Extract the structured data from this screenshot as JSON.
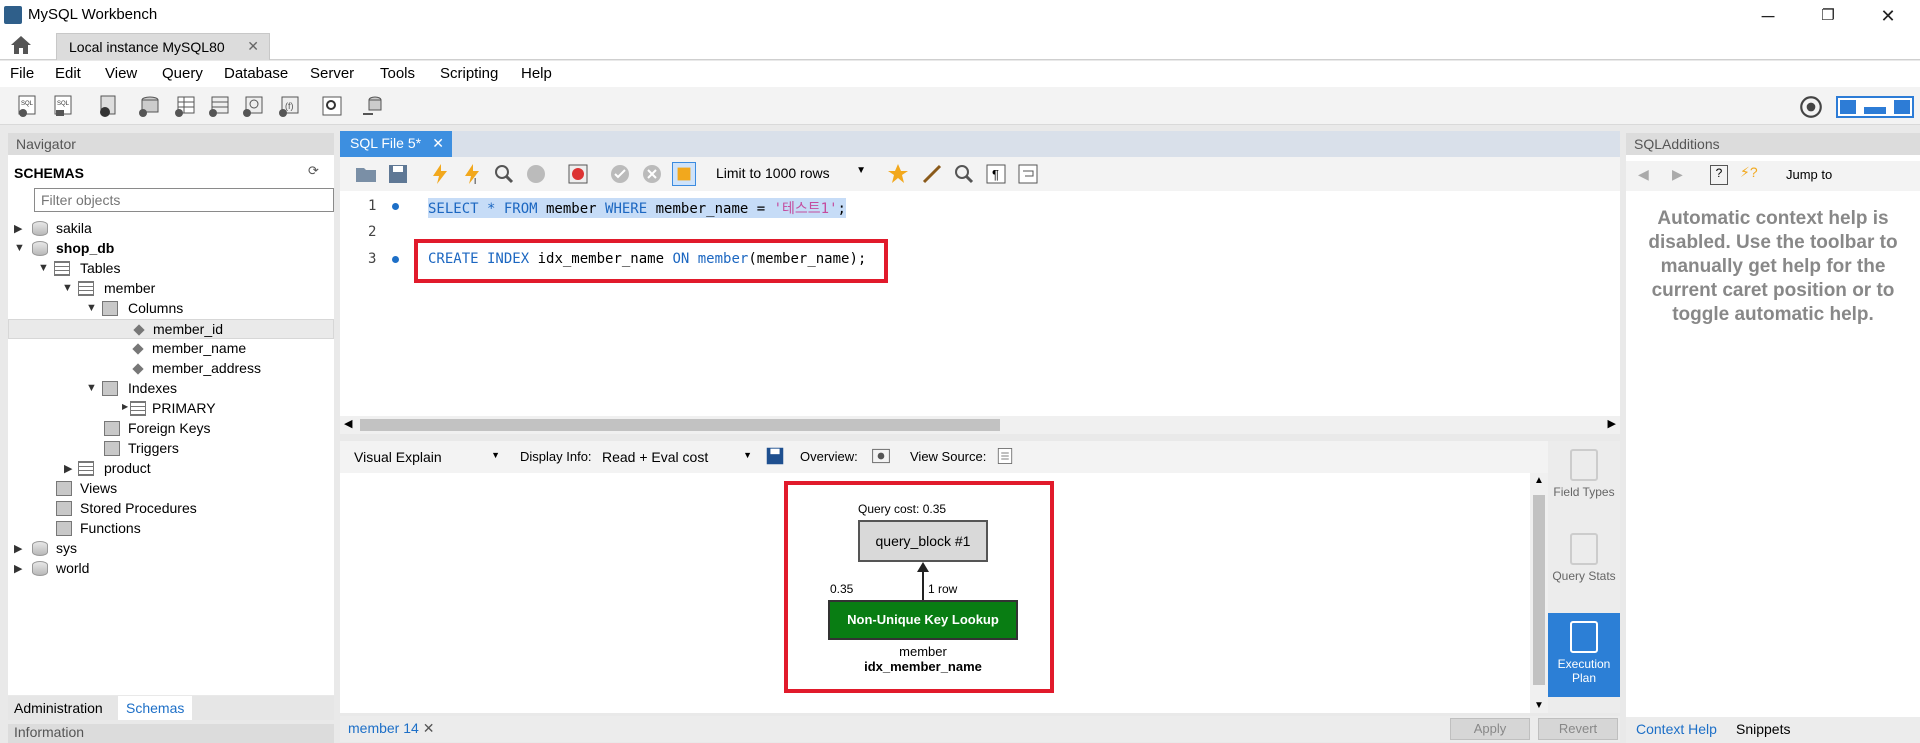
{
  "window": {
    "title": "MySQL Workbench",
    "controls": {
      "minimize": "─",
      "maximize": "❐",
      "close": "✕"
    }
  },
  "tabs": {
    "home_icon": "home-icon",
    "connection": "Local instance MySQL80",
    "close": "✕"
  },
  "menu": [
    "File",
    "Edit",
    "View",
    "Query",
    "Database",
    "Server",
    "Tools",
    "Scripting",
    "Help"
  ],
  "navigator": {
    "header": "Navigator",
    "schemas_label": "SCHEMAS",
    "filter_placeholder": "Filter objects",
    "tree": {
      "sakila": "sakila",
      "shop_db": "shop_db",
      "tables": "Tables",
      "member": "member",
      "columns": "Columns",
      "col1": "member_id",
      "col2": "member_name",
      "col3": "member_address",
      "indexes": "Indexes",
      "primary": "PRIMARY",
      "foreign_keys": "Foreign Keys",
      "triggers": "Triggers",
      "product": "product",
      "views": "Views",
      "stored_procedures": "Stored Procedures",
      "functions": "Functions",
      "sys": "sys",
      "world": "world"
    },
    "bottom_tabs": {
      "administration": "Administration",
      "schemas": "Schemas"
    },
    "info_header": "Information"
  },
  "editor": {
    "tab_label": "SQL File 5*",
    "tab_close": "✕",
    "limit_rows": "Limit to 1000 rows",
    "lines": [
      {
        "num": "1",
        "kw1": "SELECT * FROM",
        "ident": " member ",
        "kw2": "WHERE",
        "rest": " member_name = ",
        "str": "'테스트1'",
        "end": ";"
      },
      {
        "num": "2"
      },
      {
        "num": "3",
        "kw1": "CREATE INDEX",
        "ident": " idx_member_name ",
        "kw2": "ON",
        "rest2": " member",
        "paren": "(member_name);"
      }
    ],
    "accent_highlight": "#e11a2b"
  },
  "results": {
    "view_mode": "Visual Explain",
    "display_info_label": "Display Info:",
    "display_info_value": "Read + Eval cost",
    "overview_label": "Overview:",
    "view_source_label": "View Source:",
    "plan": {
      "query_cost": "Query cost: 0.35",
      "query_block": "query_block #1",
      "left_cost": "0.35",
      "rows": "1 row",
      "access_type": "Non-Unique Key Lookup",
      "table": "member",
      "index": "idx_member_name",
      "lookup_color": "#097d13"
    },
    "side_tabs": {
      "field_types": "Field Types",
      "query_stats": "Query Stats",
      "execution_plan": "Execution Plan"
    },
    "bottom_tab": "member 14",
    "apply": "Apply",
    "revert": "Revert"
  },
  "sql_additions": {
    "header": "SQLAdditions",
    "jump_to": "Jump to",
    "help_text": "Automatic context help is disabled. Use the toolbar to manually get help for the current caret position or to toggle automatic help.",
    "bottom_tabs": {
      "context_help": "Context Help",
      "snippets": "Snippets"
    }
  }
}
